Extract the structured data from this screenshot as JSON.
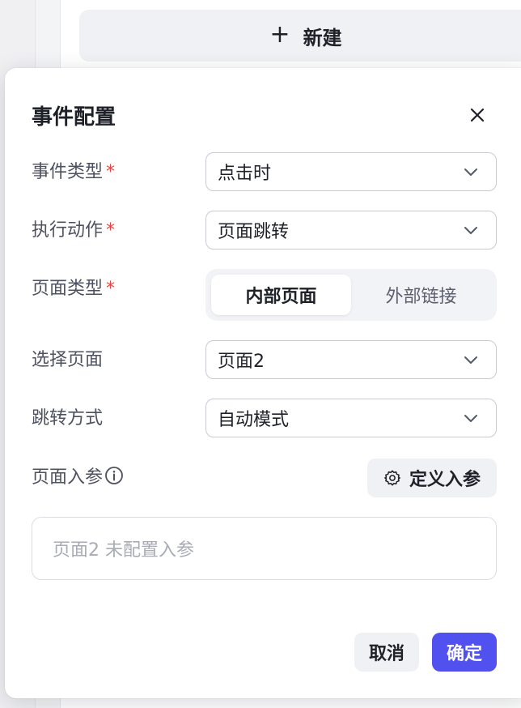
{
  "background": {
    "new_button_label": "新建",
    "new_button_icon": "plus-icon"
  },
  "dialog": {
    "title": "事件配置",
    "close_icon": "close-icon",
    "required_mark": "*",
    "fields": {
      "event_type": {
        "label": "事件类型",
        "value": "点击时",
        "required": true
      },
      "action": {
        "label": "执行动作",
        "value": "页面跳转",
        "required": true
      },
      "page_type": {
        "label": "页面类型",
        "required": true,
        "options": [
          "内部页面",
          "外部链接"
        ],
        "selected": "内部页面"
      },
      "select_page": {
        "label": "选择页面",
        "value": "页面2"
      },
      "jump_mode": {
        "label": "跳转方式",
        "value": "自动模式"
      },
      "page_params": {
        "label": "页面入参",
        "define_button": "定义入参",
        "empty_text": "页面2 未配置入参"
      }
    },
    "footer": {
      "cancel": "取消",
      "confirm": "确定"
    }
  },
  "colors": {
    "primary": "#5151f0",
    "required": "#e54545",
    "text": "#1f2129",
    "label": "#4e5160",
    "placeholder": "#a9abb5"
  }
}
